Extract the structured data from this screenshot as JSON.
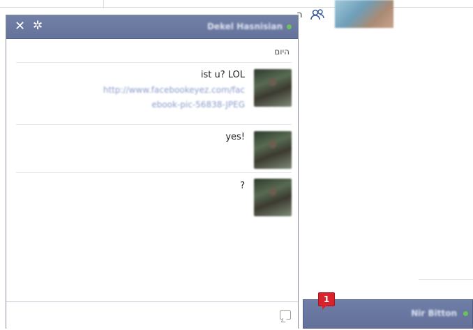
{
  "background_page": {
    "partial_text": "ה",
    "icon": "friends-icon"
  },
  "chat_window": {
    "title": "Dekel Hasnisian",
    "status": "online",
    "close_icon": "✕",
    "settings_icon": "✲",
    "day_label": "היום",
    "messages": [
      {
        "text": "ist u? LOL",
        "link": "http://www.facebookeyez.com/facebook-pic-56838-JPEG"
      },
      {
        "text": "yes!"
      },
      {
        "text": "?"
      }
    ],
    "composer_icon": "emoticon-icon"
  },
  "chat_tab": {
    "title": "Nir Bitton",
    "status": "online",
    "unread_count": "1"
  },
  "colors": {
    "header_bg": "#6b79a2",
    "online_dot": "#6ac259",
    "badge_bg": "#d8222c"
  }
}
